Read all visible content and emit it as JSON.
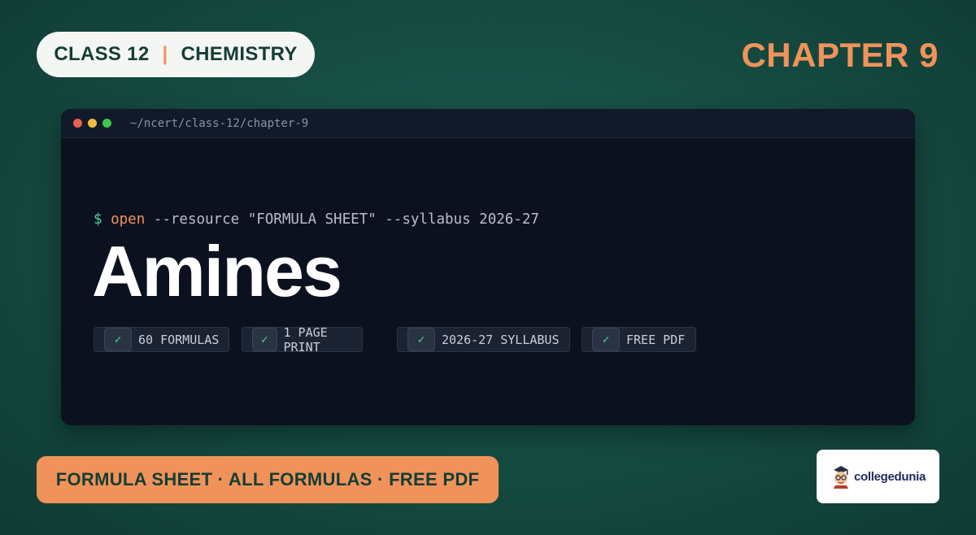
{
  "header": {
    "class_label": "CLASS 12",
    "separator": "|",
    "subject": "CHEMISTRY",
    "chapter": "CHAPTER 9"
  },
  "terminal": {
    "path": "~/ncert/class-12/chapter-9",
    "prompt": "$",
    "command": "open",
    "args": "--resource \"FORMULA SHEET\" --syllabus 2026-27",
    "title": "Amines",
    "check_mark": "✓",
    "badges": [
      {
        "label": "60 FORMULAS"
      },
      {
        "label": "1 PAGE PRINT"
      },
      {
        "label": "2026-27 SYLLABUS"
      },
      {
        "label": "FREE PDF"
      }
    ]
  },
  "footer": {
    "banner": "FORMULA SHEET · ALL FORMULAS · FREE PDF",
    "logo_text": "collegedunia"
  },
  "colors": {
    "background": "#154a41",
    "accent": "#f0935a",
    "terminal_bg": "#0c1120",
    "prompt_green": "#4fd79a"
  }
}
